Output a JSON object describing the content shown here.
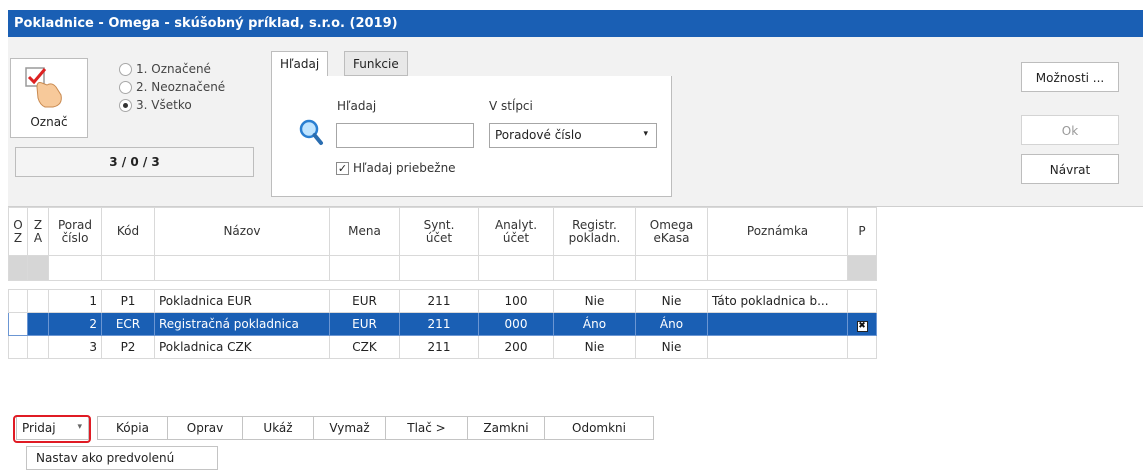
{
  "window": {
    "title": "Pokladnice - Omega - skúšobný príklad, s.r.o. (2019)"
  },
  "mark_panel": {
    "button_label": "Označ",
    "options": [
      {
        "label": "1. Označené",
        "selected": false
      },
      {
        "label": "2. Neoznačené",
        "selected": false
      },
      {
        "label": "3. Všetko",
        "selected": true
      }
    ],
    "counter": "3 / 0 / 3"
  },
  "search": {
    "tabs": [
      {
        "label": "Hľadaj",
        "active": true
      },
      {
        "label": "Funkcie",
        "active": false
      }
    ],
    "find_label": "Hľadaj",
    "find_value": "",
    "column_label": "V stĺpci",
    "column_value": "Poradové číslo",
    "live_search_label": "Hľadaj priebežne",
    "live_search_checked": true
  },
  "side_buttons": {
    "options": "Možnosti ...",
    "ok": "Ok",
    "back": "Návrat"
  },
  "grid": {
    "headers": {
      "oz": [
        "O",
        "Z"
      ],
      "za": [
        "Z",
        "A"
      ],
      "porad": [
        "Porad",
        "číslo"
      ],
      "kod": "Kód",
      "nazov": "Názov",
      "mena": "Mena",
      "synt": [
        "Synt.",
        "účet"
      ],
      "analyt": [
        "Analyt.",
        "účet"
      ],
      "registr": [
        "Registr.",
        "pokladn."
      ],
      "omega": [
        "Omega",
        "eKasa"
      ],
      "poznamka": "Poznámka",
      "p": "P"
    },
    "rows": [
      {
        "cislo": "1",
        "kod": "P1",
        "nazov": "Pokladnica EUR",
        "mena": "EUR",
        "synt": "211",
        "analyt": "100",
        "registr": "Nie",
        "omega": "Nie",
        "poznamka": "Táto pokladnica b...",
        "p": "",
        "selected": false
      },
      {
        "cislo": "2",
        "kod": "ECR",
        "nazov": "Registračná pokladnica",
        "mena": "EUR",
        "synt": "211",
        "analyt": "000",
        "registr": "Áno",
        "omega": "Áno",
        "poznamka": "",
        "p": "✖",
        "selected": true
      },
      {
        "cislo": "3",
        "kod": "P2",
        "nazov": "Pokladnica CZK",
        "mena": "CZK",
        "synt": "211",
        "analyt": "200",
        "registr": "Nie",
        "omega": "Nie",
        "poznamka": "",
        "p": "",
        "selected": false
      }
    ]
  },
  "toolbar": {
    "add": "Pridaj",
    "copy": "Kópia",
    "edit": "Oprav",
    "show": "Ukáž",
    "delete": "Vymaž",
    "print": "Tlač >",
    "lock": "Zamkni",
    "unlock": "Odomkni",
    "set_default": "Nastav ako predvolenú"
  },
  "colors": {
    "accent": "#1a5fb4",
    "highlight": "#e01b24"
  }
}
